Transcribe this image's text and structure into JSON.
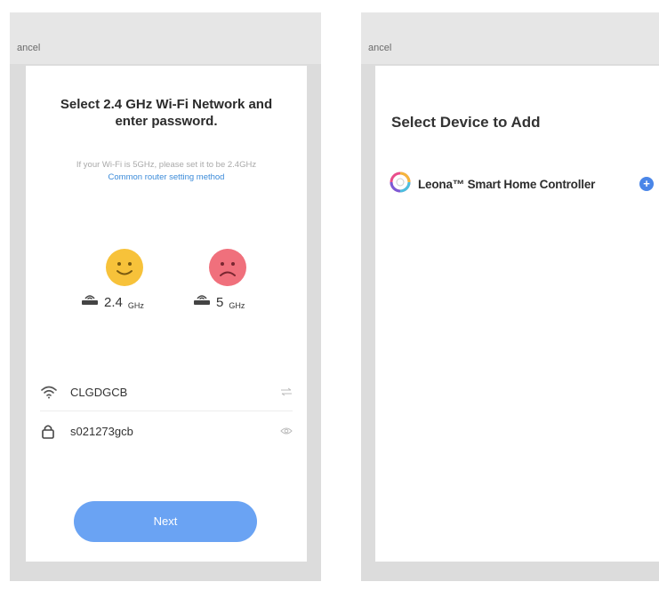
{
  "left": {
    "cancel_label": "ancel",
    "title_line1": "Select 2.4 GHz Wi-Fi Network and",
    "title_line2": "enter password.",
    "note": "If your Wi-Fi is 5GHz, please set it to be 2.4GHz",
    "router_link": "Common router setting method",
    "band_24_value": "2.4",
    "band_24_unit": "GHz",
    "band_5_value": "5",
    "band_5_unit": "GHz",
    "ssid": "CLGDGCB",
    "password": "s021273gcb",
    "next_label": "Next",
    "colors": {
      "happy": "#f7c23a",
      "sad": "#f0707c",
      "button": "#6aa3f3",
      "link": "#3c8bd9"
    }
  },
  "right": {
    "cancel_label": "ancel",
    "heading": "Select Device to Add",
    "device_name": "Leona™ Smart Home Controller",
    "add_icon": "plus-circle-icon"
  }
}
